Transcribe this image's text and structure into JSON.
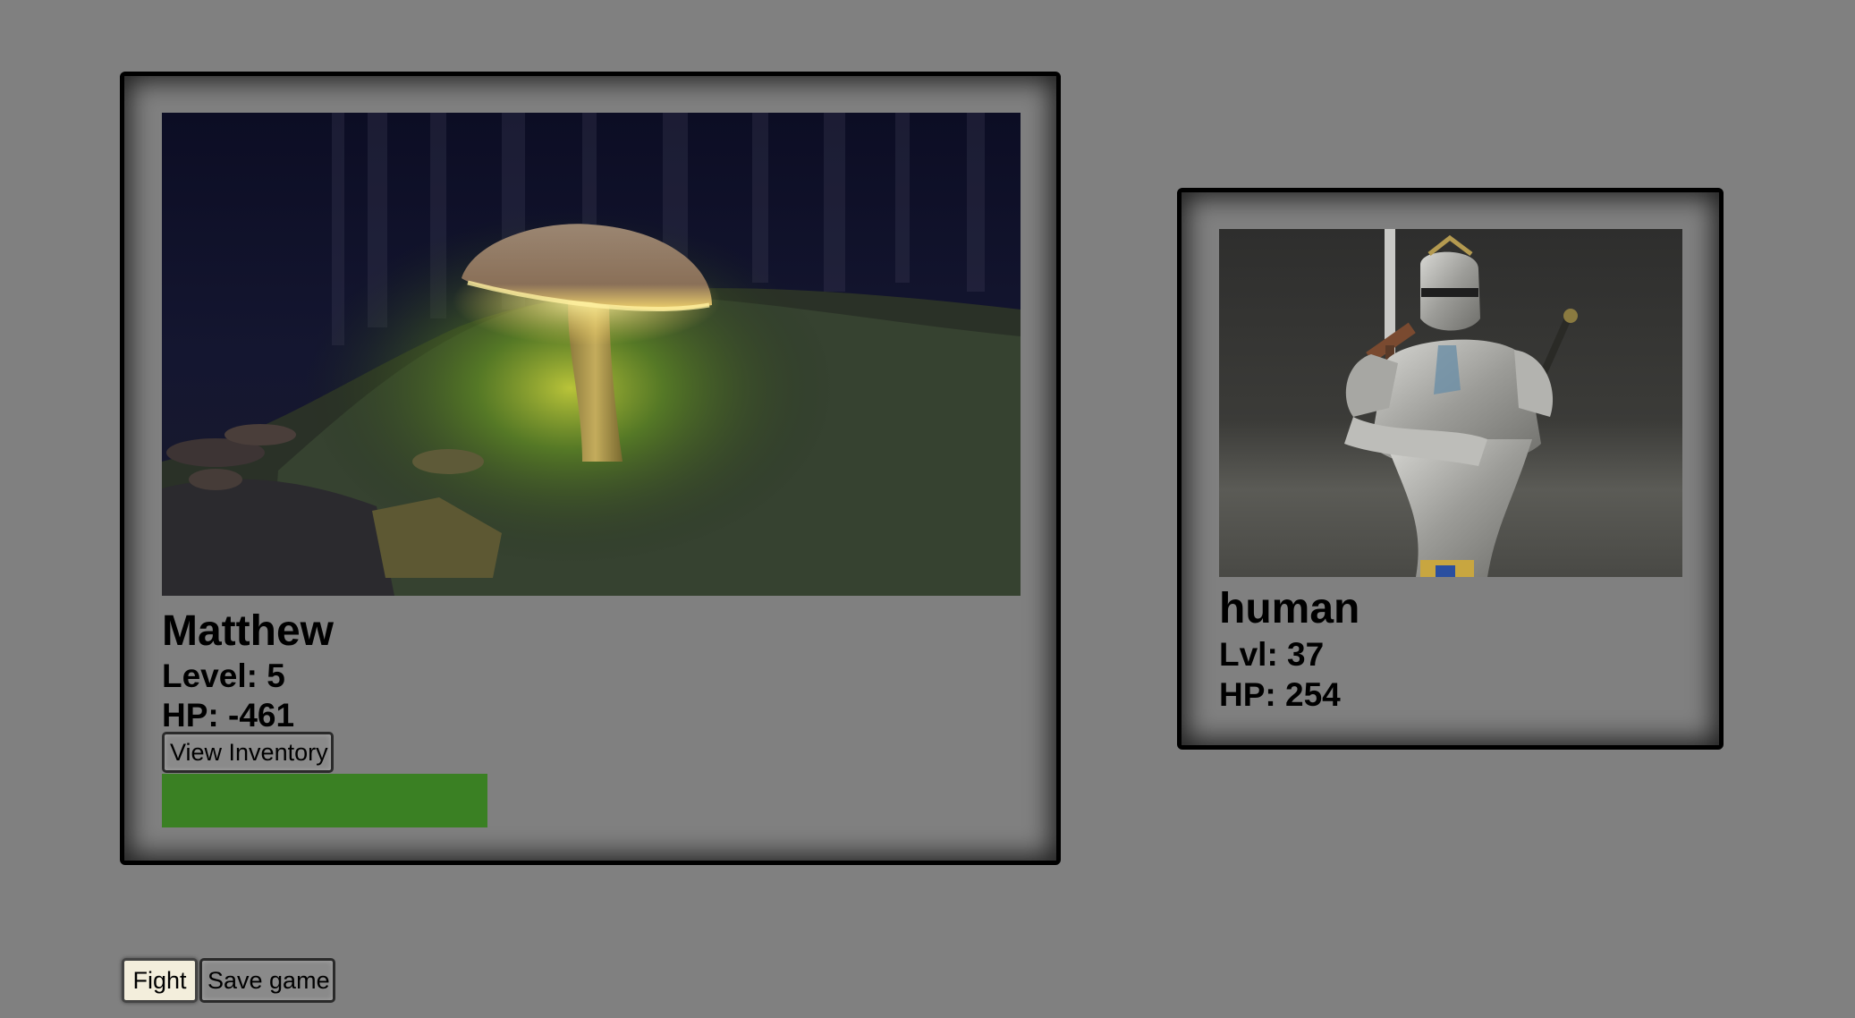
{
  "player": {
    "name": "Matthew",
    "level_text": "Level: 5",
    "hp_text": "HP: -461",
    "inventory_label": "View Inventory",
    "portrait_icon": "glowing-mushroom-image",
    "xp_bar_fill": 1.0,
    "xp_bar_color": "#3a8023"
  },
  "enemy": {
    "name": "human",
    "level_text": "Lvl: 37",
    "hp_text": "HP: 254",
    "portrait_icon": "armored-knight-image"
  },
  "controls": {
    "fight_label": "Fight",
    "save_label": "Save game"
  }
}
